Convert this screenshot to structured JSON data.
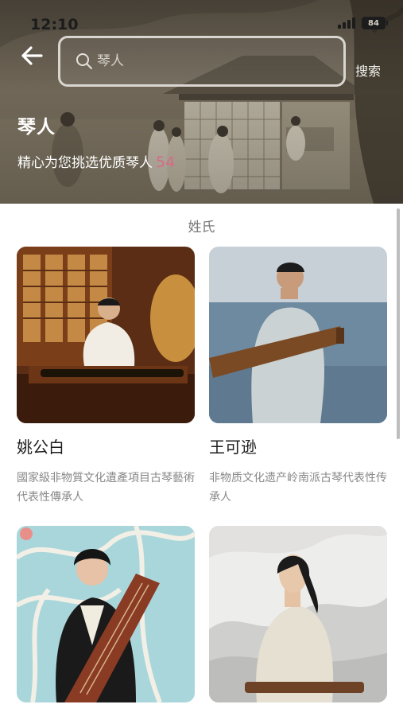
{
  "status_bar": {
    "time": "12:10",
    "battery": "84"
  },
  "search": {
    "placeholder": "琴人",
    "value": "",
    "button_label": "搜索"
  },
  "header": {
    "title": "琴人",
    "subtitle": "精心为您挑选优质琴人",
    "count": "54"
  },
  "filter": {
    "label": "姓氏"
  },
  "musicians": [
    {
      "name": "姚公白",
      "description": "國家級非物質文化遺產項目古琴藝術代表性傳承人"
    },
    {
      "name": "王可逊",
      "description": "非物质文化遗产岭南派古琴代表性传承人"
    },
    {
      "name": "",
      "description": ""
    },
    {
      "name": "",
      "description": ""
    }
  ],
  "colors": {
    "accent_count": "#d76b86",
    "text_secondary": "#888888"
  },
  "icons": {
    "back": "arrow-left-icon",
    "search": "magnifier-icon"
  }
}
